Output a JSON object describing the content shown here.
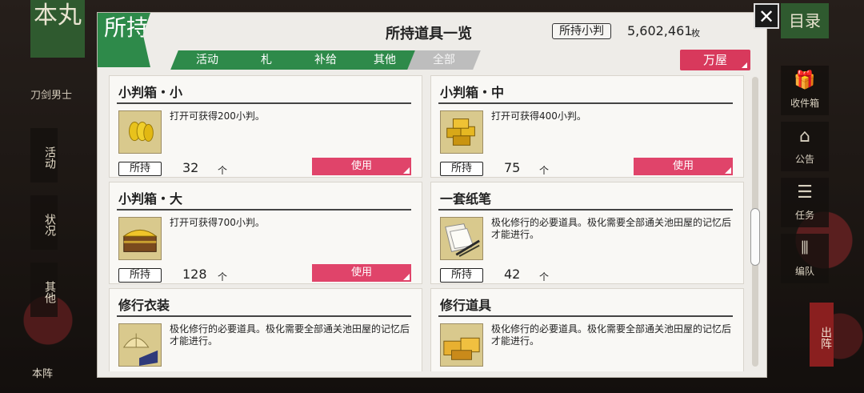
{
  "background": {
    "honmaru_label": "本丸",
    "left_label": "刀剑男士",
    "left_tabs": [
      "活动",
      "状况",
      "其他"
    ],
    "left_footer": "本阵",
    "mokuroku_label": "目录",
    "right_tabs": [
      {
        "label": "收件箱",
        "icon": "gift-icon"
      },
      {
        "label": "公告",
        "icon": "house-icon"
      },
      {
        "label": "任务",
        "icon": "checklist-icon"
      },
      {
        "label": "编队",
        "icon": "formation-icon"
      }
    ],
    "sortie_label": "出阵"
  },
  "dialog": {
    "badge": "所持",
    "title": "所持道具一览",
    "money_label": "所持小判",
    "money_value": "5,602,461",
    "money_unit": "枚",
    "tabs": [
      {
        "label": "活动",
        "active": true
      },
      {
        "label": "札",
        "active": true
      },
      {
        "label": "补给",
        "active": true
      },
      {
        "label": "其他",
        "active": true
      },
      {
        "label": "全部",
        "active": false
      }
    ],
    "shop_label": "万屋",
    "close_icon": "close-icon",
    "accent_color": "#2e8a4a",
    "button_color": "#e0446a"
  },
  "items": [
    {
      "name": "小判箱・小",
      "desc": "打开可获得200小判。",
      "owned_label": "所持",
      "count": "32",
      "unit": "个",
      "use_label": "使用",
      "icon": "coin-bag-small-icon"
    },
    {
      "name": "小判箱・中",
      "desc": "打开可获得400小判。",
      "owned_label": "所持",
      "count": "75",
      "unit": "个",
      "use_label": "使用",
      "icon": "coin-box-medium-icon"
    },
    {
      "name": "小判箱・大",
      "desc": "打开可获得700小判。",
      "owned_label": "所持",
      "count": "128",
      "unit": "个",
      "use_label": "使用",
      "icon": "treasure-chest-icon"
    },
    {
      "name": "一套纸笔",
      "desc": "极化修行的必要道具。极化需要全部通关池田屋的记忆后才能进行。",
      "owned_label": "所持",
      "count": "42",
      "unit": "个",
      "use_label": "",
      "icon": "paper-brush-icon"
    },
    {
      "name": "修行衣装",
      "desc": "极化修行的必要道具。极化需要全部通关池田屋的记忆后才能进行。",
      "icon": "travel-outfit-icon"
    },
    {
      "name": "修行道具",
      "desc": "极化修行的必要道具。极化需要全部通关池田屋的记忆后才能进行。",
      "icon": "travel-tools-icon"
    }
  ]
}
